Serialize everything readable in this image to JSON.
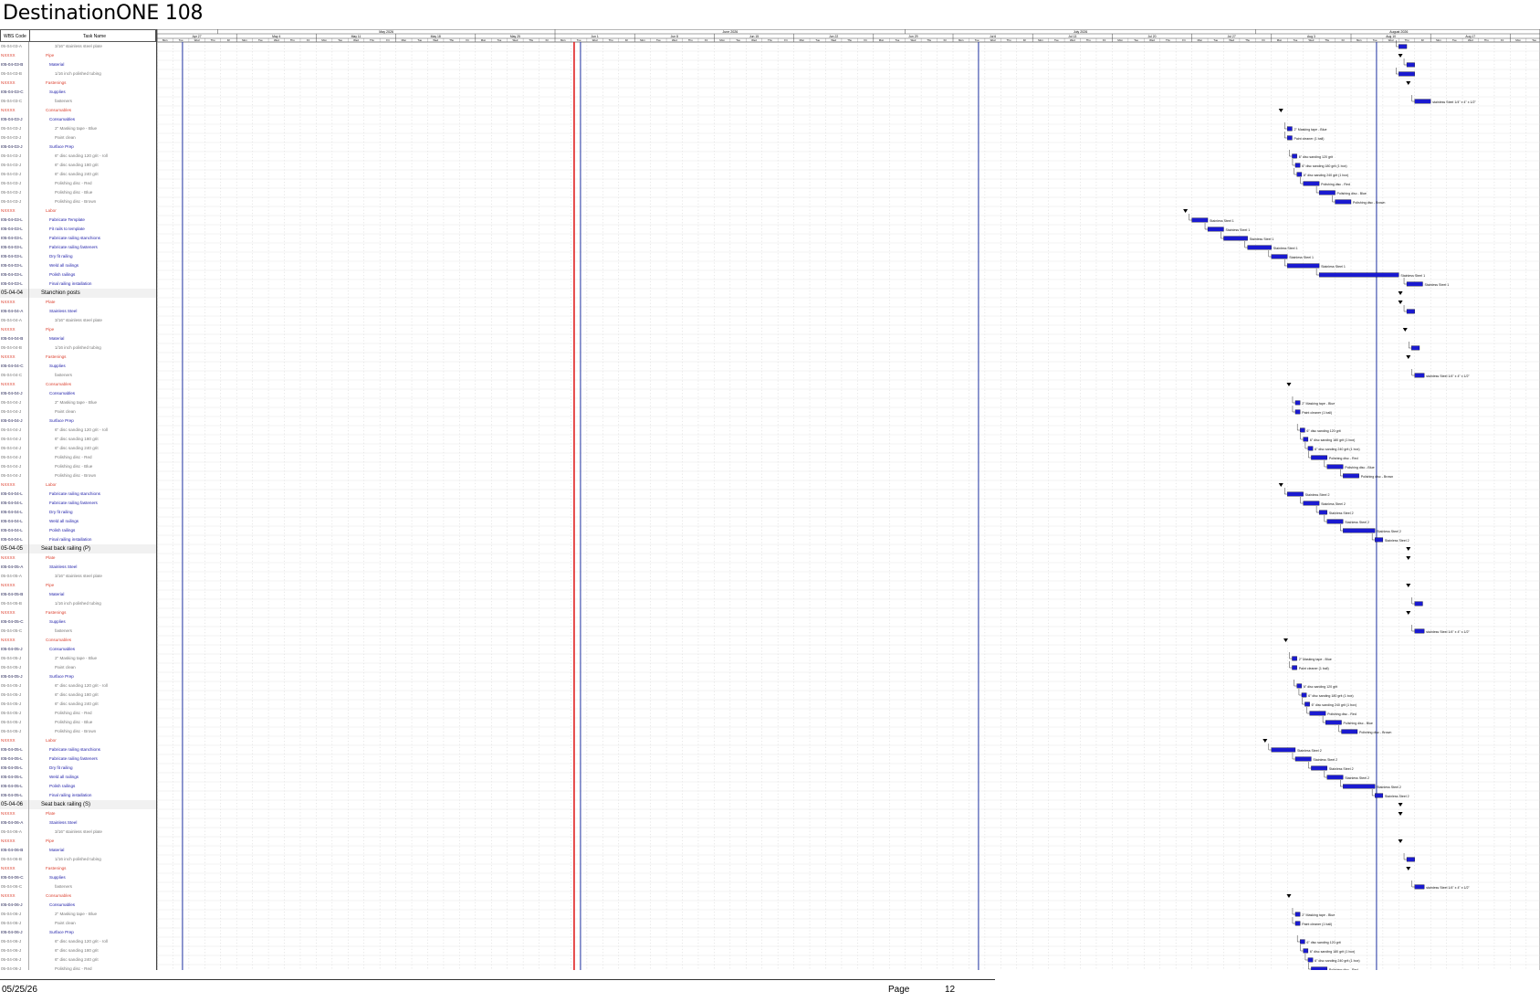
{
  "document": {
    "title": "DestinationONE 108"
  },
  "table_header": {
    "wbs": "WBS Code",
    "task": "Task Name"
  },
  "timescale": {
    "months": [
      "May 2026",
      "June 2026",
      "July 2026",
      "August 2026"
    ],
    "weeks": [
      "Apr 27",
      "May 4",
      "May 11",
      "May 18",
      "May 25",
      "Jun 1",
      "Jun 8",
      "Jun 15",
      "Jun 22",
      "Jun 29",
      "Jul 6",
      "Jul 13",
      "Jul 20",
      "Jul 27",
      "Aug 3",
      "Aug 10",
      "Aug 17",
      "Aug 24"
    ],
    "days": [
      "Mon",
      "Tue",
      "Wed",
      "Thu",
      "Fri"
    ]
  },
  "rows": [
    {
      "type": "sub",
      "wbs": "05-04-03-A",
      "name": "3/16\" stainless steel plate"
    },
    {
      "type": "cat",
      "wbs": "NXXXX",
      "name": "Pipe"
    },
    {
      "type": "task",
      "wbs": "I05-04-03-B",
      "name": "Material"
    },
    {
      "type": "sub",
      "wbs": "05-04-03-B",
      "name": "1/16 inch polished tubing"
    },
    {
      "type": "cat",
      "wbs": "NXXXX",
      "name": "Fastenings"
    },
    {
      "type": "task",
      "wbs": "I05-04-03-C",
      "name": "Supplies"
    },
    {
      "type": "sub",
      "wbs": "05-04-03-C",
      "name": "fasteners"
    },
    {
      "type": "cat",
      "wbs": "NXXXX",
      "name": "Consumables"
    },
    {
      "type": "task",
      "wbs": "I05-04-03-J",
      "name": "Consumables"
    },
    {
      "type": "sub",
      "wbs": "05-04-03-J",
      "name": "2\" Masking tape - Blue"
    },
    {
      "type": "sub",
      "wbs": "05-04-03-J",
      "name": "Paint clean"
    },
    {
      "type": "task",
      "wbs": "I05-04-03-J",
      "name": "Surface Prep"
    },
    {
      "type": "sub",
      "wbs": "05-04-03-J",
      "name": "6\" disc sanding 120 grit - roll"
    },
    {
      "type": "sub",
      "wbs": "05-04-03-J",
      "name": "6\" disc sanding 180 grit"
    },
    {
      "type": "sub",
      "wbs": "05-04-03-J",
      "name": "6\" disc sanding 240 grit"
    },
    {
      "type": "sub",
      "wbs": "05-04-03-J",
      "name": "Polishing disc - Red"
    },
    {
      "type": "sub",
      "wbs": "05-04-03-J",
      "name": "Polishing disc - Blue"
    },
    {
      "type": "sub",
      "wbs": "05-04-03-J",
      "name": "Polishing disc - Brown"
    },
    {
      "type": "cat",
      "wbs": "NXXXX",
      "name": "Labor"
    },
    {
      "type": "task",
      "wbs": "I05-04-03-L",
      "name": "Fabricate Template"
    },
    {
      "type": "task",
      "wbs": "I05-04-03-L",
      "name": "Fit rails to template"
    },
    {
      "type": "task",
      "wbs": "I05-04-03-L",
      "name": "Fabricate railing stanchions"
    },
    {
      "type": "task",
      "wbs": "I05-04-03-L",
      "name": "Fabricate railing fasteners"
    },
    {
      "type": "task",
      "wbs": "I05-04-03-L",
      "name": "Dry fit railing"
    },
    {
      "type": "task",
      "wbs": "I05-04-03-L",
      "name": "Weld all railings"
    },
    {
      "type": "task",
      "wbs": "I05-04-03-L",
      "name": "Polish railings"
    },
    {
      "type": "task",
      "wbs": "I05-04-03-L",
      "name": "Final railing installation"
    },
    {
      "type": "sum",
      "wbs": "05-04-04",
      "name": "Stanchion posts"
    },
    {
      "type": "cat",
      "wbs": "NXXXX",
      "name": "Plate"
    },
    {
      "type": "task",
      "wbs": "I05-04-04-A",
      "name": "Stainless Steel"
    },
    {
      "type": "sub",
      "wbs": "05-04-04-A",
      "name": "3/16\" stainless steel plate"
    },
    {
      "type": "cat",
      "wbs": "NXXXX",
      "name": "Pipe"
    },
    {
      "type": "task",
      "wbs": "I05-04-04-B",
      "name": "Material"
    },
    {
      "type": "sub",
      "wbs": "05-04-04-B",
      "name": "1/16 inch polished tubing"
    },
    {
      "type": "cat",
      "wbs": "NXXXX",
      "name": "Fastenings"
    },
    {
      "type": "task",
      "wbs": "I05-04-04-C",
      "name": "Supplies"
    },
    {
      "type": "sub",
      "wbs": "05-04-04-C",
      "name": "fasteners"
    },
    {
      "type": "cat",
      "wbs": "NXXXX",
      "name": "Consumables"
    },
    {
      "type": "task",
      "wbs": "I05-04-04-J",
      "name": "Consumables"
    },
    {
      "type": "sub",
      "wbs": "05-04-04-J",
      "name": "2\" Masking tape - Blue"
    },
    {
      "type": "sub",
      "wbs": "05-04-04-J",
      "name": "Paint clean"
    },
    {
      "type": "task",
      "wbs": "I05-04-04-J",
      "name": "Surface Prep"
    },
    {
      "type": "sub",
      "wbs": "05-04-04-J",
      "name": "6\" disc sanding 120 grit - roll"
    },
    {
      "type": "sub",
      "wbs": "05-04-04-J",
      "name": "6\" disc sanding 180 grit"
    },
    {
      "type": "sub",
      "wbs": "05-04-04-J",
      "name": "6\" disc sanding 240 grit"
    },
    {
      "type": "sub",
      "wbs": "05-04-04-J",
      "name": "Polishing disc - Red"
    },
    {
      "type": "sub",
      "wbs": "05-04-04-J",
      "name": "Polishing disc - Blue"
    },
    {
      "type": "sub",
      "wbs": "05-04-04-J",
      "name": "Polishing disc - Brown"
    },
    {
      "type": "cat",
      "wbs": "NXXXX",
      "name": "Labor"
    },
    {
      "type": "task",
      "wbs": "I05-04-04-L",
      "name": "Fabricate railing stanchions"
    },
    {
      "type": "task",
      "wbs": "I05-04-04-L",
      "name": "Fabricate railing fasteners"
    },
    {
      "type": "task",
      "wbs": "I05-04-04-L",
      "name": "Dry fit railing"
    },
    {
      "type": "task",
      "wbs": "I05-04-04-L",
      "name": "Weld all railings"
    },
    {
      "type": "task",
      "wbs": "I05-04-04-L",
      "name": "Polish railings"
    },
    {
      "type": "task",
      "wbs": "I05-04-04-L",
      "name": "Final railing installation"
    },
    {
      "type": "sum",
      "wbs": "05-04-05",
      "name": "Seat back railing (P)"
    },
    {
      "type": "cat",
      "wbs": "NXXXX",
      "name": "Plate"
    },
    {
      "type": "task",
      "wbs": "I05-04-05-A",
      "name": "Stainless Steel"
    },
    {
      "type": "sub",
      "wbs": "05-04-05-A",
      "name": "3/16\" stainless steel plate"
    },
    {
      "type": "cat",
      "wbs": "NXXXX",
      "name": "Pipe"
    },
    {
      "type": "task",
      "wbs": "I05-04-05-B",
      "name": "Material"
    },
    {
      "type": "sub",
      "wbs": "05-04-05-B",
      "name": "1/16 inch polished tubing"
    },
    {
      "type": "cat",
      "wbs": "NXXXX",
      "name": "Fastenings"
    },
    {
      "type": "task",
      "wbs": "I05-04-05-C",
      "name": "Supplies"
    },
    {
      "type": "sub",
      "wbs": "05-04-05-C",
      "name": "fasteners"
    },
    {
      "type": "cat",
      "wbs": "NXXXX",
      "name": "Consumables"
    },
    {
      "type": "task",
      "wbs": "I05-04-05-J",
      "name": "Consumables"
    },
    {
      "type": "sub",
      "wbs": "05-04-05-J",
      "name": "2\" Masking tape - Blue"
    },
    {
      "type": "sub",
      "wbs": "05-04-05-J",
      "name": "Paint clean"
    },
    {
      "type": "task",
      "wbs": "I05-04-05-J",
      "name": "Surface Prep"
    },
    {
      "type": "sub",
      "wbs": "05-04-05-J",
      "name": "6\" disc sanding 120 grit - roll"
    },
    {
      "type": "sub",
      "wbs": "05-04-05-J",
      "name": "6\" disc sanding 180 grit"
    },
    {
      "type": "sub",
      "wbs": "05-04-05-J",
      "name": "6\" disc sanding 240 grit"
    },
    {
      "type": "sub",
      "wbs": "05-04-05-J",
      "name": "Polishing disc - Red"
    },
    {
      "type": "sub",
      "wbs": "05-04-05-J",
      "name": "Polishing disc - Blue"
    },
    {
      "type": "sub",
      "wbs": "05-04-05-J",
      "name": "Polishing disc - Brown"
    },
    {
      "type": "cat",
      "wbs": "NXXXX",
      "name": "Labor"
    },
    {
      "type": "task",
      "wbs": "I05-04-05-L",
      "name": "Fabricate railing stanchions"
    },
    {
      "type": "task",
      "wbs": "I05-04-05-L",
      "name": "Fabricate railing fasteners"
    },
    {
      "type": "task",
      "wbs": "I05-04-05-L",
      "name": "Dry fit railing"
    },
    {
      "type": "task",
      "wbs": "I05-04-05-L",
      "name": "Weld all railings"
    },
    {
      "type": "task",
      "wbs": "I05-04-05-L",
      "name": "Polish railings"
    },
    {
      "type": "task",
      "wbs": "I05-04-05-L",
      "name": "Final railing installation"
    },
    {
      "type": "sum",
      "wbs": "05-04-06",
      "name": "Seat back railing (S)"
    },
    {
      "type": "cat",
      "wbs": "NXXXX",
      "name": "Plate"
    },
    {
      "type": "task",
      "wbs": "I05-04-06-A",
      "name": "Stainless Steel"
    },
    {
      "type": "sub",
      "wbs": "05-04-06-A",
      "name": "3/16\" stainless steel plate"
    },
    {
      "type": "cat",
      "wbs": "NXXXX",
      "name": "Pipe"
    },
    {
      "type": "task",
      "wbs": "I05-04-06-B",
      "name": "Material"
    },
    {
      "type": "sub",
      "wbs": "05-04-06-B",
      "name": "1/16 inch polished tubing"
    },
    {
      "type": "cat",
      "wbs": "NXXXX",
      "name": "Fastenings"
    },
    {
      "type": "task",
      "wbs": "I05-04-06-C",
      "name": "Supplies"
    },
    {
      "type": "sub",
      "wbs": "05-04-06-C",
      "name": "fasteners"
    },
    {
      "type": "cat",
      "wbs": "NXXXX",
      "name": "Consumables"
    },
    {
      "type": "task",
      "wbs": "I05-04-06-J",
      "name": "Consumables"
    },
    {
      "type": "sub",
      "wbs": "05-04-06-J",
      "name": "2\" Masking tape - Blue"
    },
    {
      "type": "sub",
      "wbs": "05-04-06-J",
      "name": "Paint clean"
    },
    {
      "type": "task",
      "wbs": "I05-04-06-J",
      "name": "Surface Prep"
    },
    {
      "type": "sub",
      "wbs": "05-04-06-J",
      "name": "6\" disc sanding 120 grit - roll"
    },
    {
      "type": "sub",
      "wbs": "05-04-06-J",
      "name": "6\" disc sanding 180 grit"
    },
    {
      "type": "sub",
      "wbs": "05-04-06-J",
      "name": "6\" disc sanding 240 grit"
    },
    {
      "type": "sub",
      "wbs": "05-04-06-J",
      "name": "Polishing disc - Red"
    }
  ],
  "bars": [
    {
      "row": 0,
      "start": 78.0,
      "dur": 0.5
    },
    {
      "row": 2,
      "start": 78.5,
      "dur": 0.5
    },
    {
      "row": 3,
      "start": 78.0,
      "dur": 1.0
    },
    {
      "row": 6,
      "start": 79.0,
      "dur": 1.0,
      "label": "stainless Steel 1/4\" x 4\" x 1/2\""
    },
    {
      "row": 9,
      "start": 71.0,
      "dur": 0.3,
      "label": "2\" Masking tape - Blue"
    },
    {
      "row": 10,
      "start": 71.0,
      "dur": 0.3,
      "label": "Paint cleaner (1 ball)"
    },
    {
      "row": 12,
      "start": 71.3,
      "dur": 0.3,
      "label": "6\" disc sanding 120 grit"
    },
    {
      "row": 13,
      "start": 71.5,
      "dur": 0.3,
      "label": "6\" disc sanding 180 grit (1 box)"
    },
    {
      "row": 14,
      "start": 71.6,
      "dur": 0.3,
      "label": "6\" disc sanding 240 grit (1 box)"
    },
    {
      "row": 15,
      "start": 72.0,
      "dur": 1.0,
      "label": "Polishing disc - Red"
    },
    {
      "row": 16,
      "start": 73.0,
      "dur": 1.0,
      "label": "Polishing disc - Blue"
    },
    {
      "row": 17,
      "start": 74.0,
      "dur": 1.0,
      "label": "Polishing disc - Brown"
    },
    {
      "row": 19,
      "start": 65.0,
      "dur": 1.0,
      "label": "Stainless Steel 1"
    },
    {
      "row": 20,
      "start": 66.0,
      "dur": 1.0,
      "label": "Stainless Steel 1"
    },
    {
      "row": 21,
      "start": 67.0,
      "dur": 1.5,
      "label": "Stainless Steel 1"
    },
    {
      "row": 22,
      "start": 68.5,
      "dur": 1.5,
      "label": "Stainless Steel 1"
    },
    {
      "row": 23,
      "start": 70.0,
      "dur": 1.0,
      "label": "Stainless Steel 1"
    },
    {
      "row": 24,
      "start": 71.0,
      "dur": 2.0,
      "label": "Stainless Steel 1"
    },
    {
      "row": 25,
      "start": 73.0,
      "dur": 5.0,
      "label": "Stainless Steel 1"
    },
    {
      "row": 26,
      "start": 78.5,
      "dur": 1.0,
      "label": "Stainless Steel 1"
    },
    {
      "row": 29,
      "start": 78.5,
      "dur": 0.5
    },
    {
      "row": 33,
      "start": 78.8,
      "dur": 0.5
    },
    {
      "row": 36,
      "start": 79.0,
      "dur": 0.6,
      "label": "stainless Steel 1/4\" x 4\" x 1/2\""
    },
    {
      "row": 39,
      "start": 71.5,
      "dur": 0.3,
      "label": "2\" Masking tape - Blue"
    },
    {
      "row": 40,
      "start": 71.5,
      "dur": 0.3,
      "label": "Paint cleaner (1 ball)"
    },
    {
      "row": 42,
      "start": 71.8,
      "dur": 0.3,
      "label": "6\" disc sanding 120 grit"
    },
    {
      "row": 43,
      "start": 72.0,
      "dur": 0.3,
      "label": "6\" disc sanding 180 grit (1 box)"
    },
    {
      "row": 44,
      "start": 72.3,
      "dur": 0.3,
      "label": "6\" disc sanding 240 grit (1 box)"
    },
    {
      "row": 45,
      "start": 72.5,
      "dur": 1.0,
      "label": "Polishing disc - Red"
    },
    {
      "row": 46,
      "start": 73.5,
      "dur": 1.0,
      "label": "Polishing disc - Blue"
    },
    {
      "row": 47,
      "start": 74.5,
      "dur": 1.0,
      "label": "Polishing disc - Brown"
    },
    {
      "row": 49,
      "start": 71.0,
      "dur": 1.0,
      "label": "Stainless Steel 2"
    },
    {
      "row": 50,
      "start": 72.0,
      "dur": 1.0,
      "label": "Stainless Steel 2"
    },
    {
      "row": 51,
      "start": 73.0,
      "dur": 0.5,
      "label": "Stainless Steel 2"
    },
    {
      "row": 52,
      "start": 73.5,
      "dur": 1.0,
      "label": "Stainless Steel 2"
    },
    {
      "row": 53,
      "start": 74.5,
      "dur": 2.0,
      "label": "Stainless Steel 2"
    },
    {
      "row": 54,
      "start": 76.5,
      "dur": 0.5,
      "label": "Stainless Steel 2"
    },
    {
      "row": 61,
      "start": 79.0,
      "dur": 0.5
    },
    {
      "row": 64,
      "start": 79.0,
      "dur": 0.6,
      "label": "stainless Steel 1/4\" x 4\" x 1/2\""
    },
    {
      "row": 67,
      "start": 71.3,
      "dur": 0.3,
      "label": "2\" Masking tape - Blue"
    },
    {
      "row": 68,
      "start": 71.3,
      "dur": 0.3,
      "label": "Paint cleaner (1 ball)"
    },
    {
      "row": 70,
      "start": 71.6,
      "dur": 0.3,
      "label": "6\" disc sanding 120 grit"
    },
    {
      "row": 71,
      "start": 71.9,
      "dur": 0.3,
      "label": "6\" disc sanding 180 grit (1 box)"
    },
    {
      "row": 72,
      "start": 72.1,
      "dur": 0.3,
      "label": "6\" disc sanding 240 grit (1 box)"
    },
    {
      "row": 73,
      "start": 72.4,
      "dur": 1.0,
      "label": "Polishing disc - Red"
    },
    {
      "row": 74,
      "start": 73.4,
      "dur": 1.0,
      "label": "Polishing disc - Blue"
    },
    {
      "row": 75,
      "start": 74.4,
      "dur": 1.0,
      "label": "Polishing disc - Brown"
    },
    {
      "row": 77,
      "start": 70.0,
      "dur": 1.5,
      "label": "Stainless Steel 2"
    },
    {
      "row": 78,
      "start": 71.5,
      "dur": 1.0,
      "label": "Stainless Steel 2"
    },
    {
      "row": 79,
      "start": 72.5,
      "dur": 1.0,
      "label": "Stainless Steel 2"
    },
    {
      "row": 80,
      "start": 73.5,
      "dur": 1.0,
      "label": "Stainless Steel 2"
    },
    {
      "row": 81,
      "start": 74.5,
      "dur": 2.0,
      "label": "Stainless Steel 2"
    },
    {
      "row": 82,
      "start": 76.5,
      "dur": 0.5,
      "label": "Stainless Steel 2"
    },
    {
      "row": 89,
      "start": 78.5,
      "dur": 0.5
    },
    {
      "row": 92,
      "start": 79.0,
      "dur": 0.6,
      "label": "stainless Steel 1/4\" x 4\" x 1/2\""
    },
    {
      "row": 95,
      "start": 71.5,
      "dur": 0.3,
      "label": "2\" Masking tape - Blue"
    },
    {
      "row": 96,
      "start": 71.5,
      "dur": 0.3,
      "label": "Paint cleaner (1 ball)"
    },
    {
      "row": 98,
      "start": 71.8,
      "dur": 0.3,
      "label": "6\" disc sanding 120 grit"
    },
    {
      "row": 99,
      "start": 72.0,
      "dur": 0.3,
      "label": "6\" disc sanding 180 grit (1 box)"
    },
    {
      "row": 100,
      "start": 72.3,
      "dur": 0.3,
      "label": "6\" disc sanding 240 grit (1 box)"
    },
    {
      "row": 101,
      "start": 72.5,
      "dur": 1.0,
      "label": "Polishing disc - Red"
    }
  ],
  "markers": {
    "today_workday": 22,
    "week_separators_workday": [
      0,
      25,
      50,
      75
    ]
  },
  "colors": {
    "bar": "#1a1ad0",
    "today_line": "#e02020",
    "period_line": "#3344aa",
    "category_text": "#dd4433"
  },
  "footer": {
    "date": "05/25/26",
    "page_label": "Page",
    "page_number": "12"
  }
}
